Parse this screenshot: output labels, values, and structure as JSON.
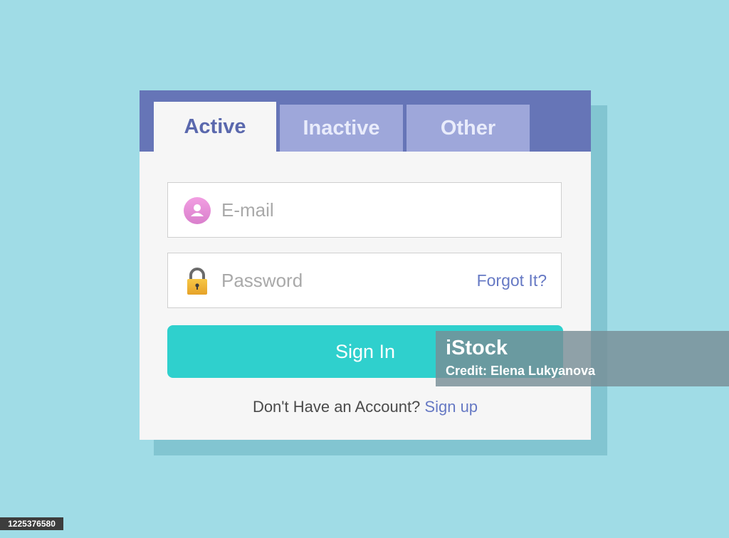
{
  "tabs": [
    {
      "label": "Active",
      "state": "active"
    },
    {
      "label": "Inactive",
      "state": "inactive"
    },
    {
      "label": "Other",
      "state": "inactive"
    }
  ],
  "email": {
    "placeholder": "E-mail",
    "value": "",
    "icon": "user-icon"
  },
  "password": {
    "placeholder": "Password",
    "value": "",
    "icon": "lock-icon",
    "forgot_label": "Forgot It?"
  },
  "signin": {
    "label": "Sign In"
  },
  "signup": {
    "prompt": "Don't Have an Account?",
    "link_label": "Sign up"
  },
  "watermark": {
    "logo": "iStock",
    "credit": "Credit: Elena Lukyanova"
  },
  "stock_id": "1225376580",
  "colors": {
    "background": "#a0dce6",
    "tab_bar": "#6675b7",
    "tab_inactive": "#9ea7da",
    "accent_button": "#2fd0cd",
    "link": "#6679c4",
    "user_icon": "#e58fd6",
    "lock_icon": "#f1b530"
  }
}
